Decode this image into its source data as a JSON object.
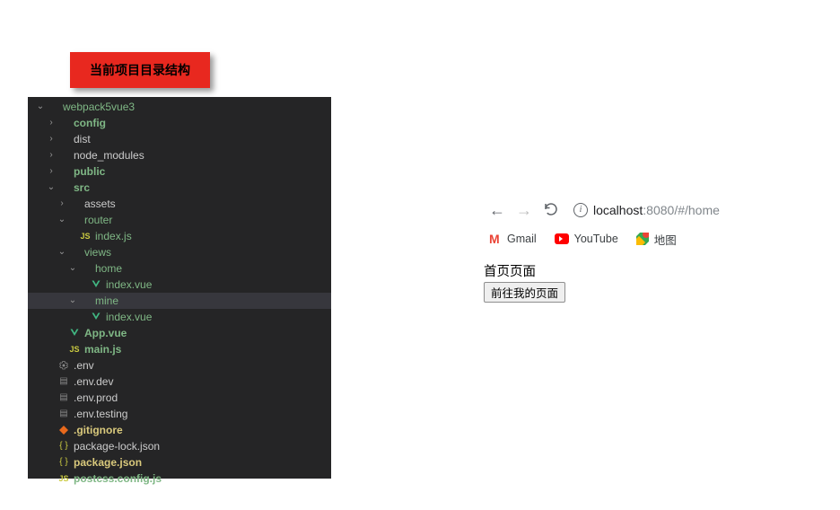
{
  "callout": {
    "label": "当前项目目录结构"
  },
  "tree": [
    {
      "indent": 0,
      "chev": "down",
      "icon": "none",
      "label": "webpack5vue3",
      "color": "green",
      "selected": false
    },
    {
      "indent": 1,
      "chev": "right",
      "icon": "none",
      "label": "config",
      "color": "green",
      "bold": true,
      "selected": false
    },
    {
      "indent": 1,
      "chev": "right",
      "icon": "none",
      "label": "dist",
      "color": "",
      "selected": false
    },
    {
      "indent": 1,
      "chev": "right",
      "icon": "none",
      "label": "node_modules",
      "color": "",
      "selected": false
    },
    {
      "indent": 1,
      "chev": "right",
      "icon": "none",
      "label": "public",
      "color": "green",
      "bold": true,
      "selected": false
    },
    {
      "indent": 1,
      "chev": "down",
      "icon": "none",
      "label": "src",
      "color": "green",
      "bold": true,
      "selected": false
    },
    {
      "indent": 2,
      "chev": "right",
      "icon": "none",
      "label": "assets",
      "color": "",
      "selected": false
    },
    {
      "indent": 2,
      "chev": "down",
      "icon": "none",
      "label": "router",
      "color": "green",
      "selected": false
    },
    {
      "indent": 3,
      "chev": "",
      "icon": "js",
      "label": "index.js",
      "color": "green",
      "selected": false
    },
    {
      "indent": 2,
      "chev": "down",
      "icon": "none",
      "label": "views",
      "color": "green",
      "selected": false
    },
    {
      "indent": 3,
      "chev": "down",
      "icon": "none",
      "label": "home",
      "color": "green",
      "selected": false
    },
    {
      "indent": 4,
      "chev": "",
      "icon": "vue",
      "label": "index.vue",
      "color": "green",
      "selected": false
    },
    {
      "indent": 3,
      "chev": "down",
      "icon": "none",
      "label": "mine",
      "color": "green",
      "selected": true
    },
    {
      "indent": 4,
      "chev": "",
      "icon": "vue",
      "label": "index.vue",
      "color": "green",
      "selected": false
    },
    {
      "indent": 2,
      "chev": "",
      "icon": "vue",
      "label": "App.vue",
      "color": "green",
      "bold": true,
      "selected": false
    },
    {
      "indent": 2,
      "chev": "",
      "icon": "js",
      "label": "main.js",
      "color": "green",
      "bold": true,
      "selected": false
    },
    {
      "indent": 1,
      "chev": "",
      "icon": "gear",
      "label": ".env",
      "color": "",
      "selected": false
    },
    {
      "indent": 1,
      "chev": "",
      "icon": "file",
      "label": ".env.dev",
      "color": "",
      "selected": false
    },
    {
      "indent": 1,
      "chev": "",
      "icon": "file",
      "label": ".env.prod",
      "color": "",
      "selected": false
    },
    {
      "indent": 1,
      "chev": "",
      "icon": "file",
      "label": ".env.testing",
      "color": "",
      "selected": false
    },
    {
      "indent": 1,
      "chev": "",
      "icon": "git",
      "label": ".gitignore",
      "color": "yellow",
      "bold": true,
      "selected": false
    },
    {
      "indent": 1,
      "chev": "",
      "icon": "json",
      "label": "package-lock.json",
      "color": "",
      "selected": false
    },
    {
      "indent": 1,
      "chev": "",
      "icon": "json",
      "label": "package.json",
      "color": "yellow",
      "bold": true,
      "selected": false
    },
    {
      "indent": 1,
      "chev": "",
      "icon": "js",
      "label": "postcss.config.js",
      "color": "green",
      "bold": true,
      "selected": false
    }
  ],
  "browser": {
    "url_host": "localhost",
    "url_port": ":8080",
    "url_path": "/#/home",
    "bookmarks": {
      "gmail": "Gmail",
      "youtube": "YouTube",
      "maps": "地图"
    },
    "page": {
      "heading": "首页页面",
      "button": "前往我的页面"
    }
  }
}
